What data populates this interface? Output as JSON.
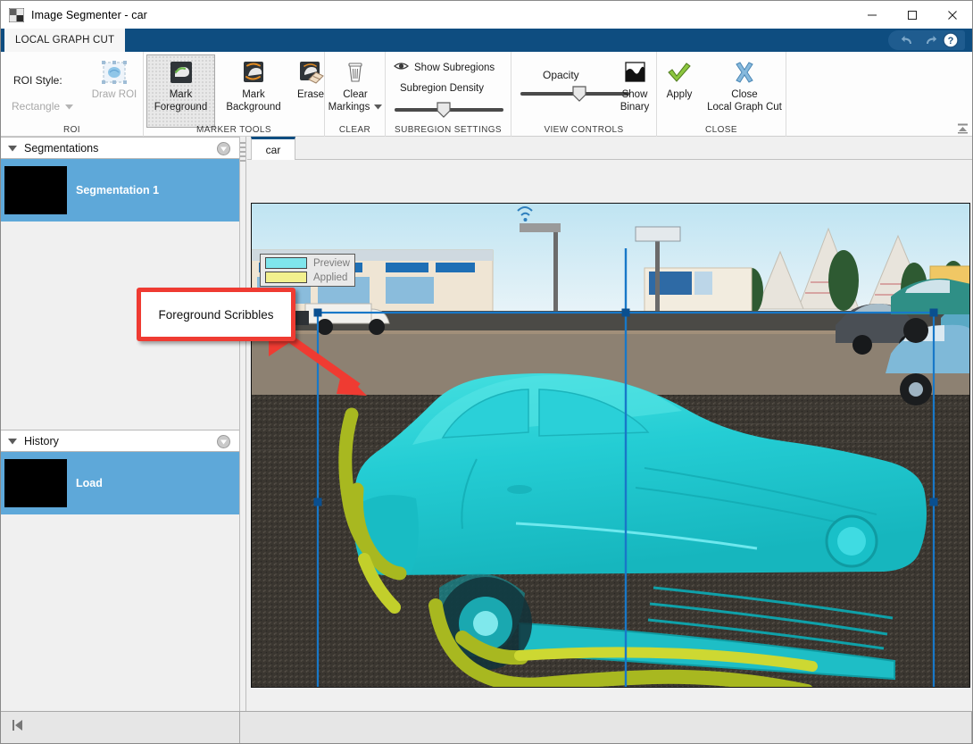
{
  "window": {
    "title": "Image Segmenter - car",
    "app_icon": "image-segmenter-icon",
    "minimize_label": "Minimize",
    "maximize_label": "Maximize",
    "close_label": "Close"
  },
  "ribbon": {
    "tab_label": "LOCAL GRAPH CUT",
    "quick_access": {
      "undo_label": "Undo",
      "redo_label": "Redo",
      "help_label": "Help"
    },
    "collapse_label": "Minimize Ribbon",
    "groups": [
      {
        "name": "ROI",
        "title": "ROI",
        "roi_style_label": "ROI Style:",
        "roi_style_value": "Rectangle",
        "draw_roi_label": "Draw ROI"
      },
      {
        "name": "MARKER TOOLS",
        "title": "MARKER TOOLS",
        "mark_foreground_label": "Mark\nForeground",
        "mark_foreground_line1": "Mark",
        "mark_foreground_line2": "Foreground",
        "mark_background_line1": "Mark",
        "mark_background_line2": "Background",
        "erase_label": "Erase"
      },
      {
        "name": "CLEAR",
        "title": "CLEAR",
        "clear_line1": "Clear",
        "clear_line2": "Markings"
      },
      {
        "name": "SUBREGION SETTINGS",
        "title": "SUBREGION SETTINGS",
        "show_subregions_label": "Show Subregions",
        "subregion_density_label": "Subregion Density",
        "subregion_density_value": 45
      },
      {
        "name": "VIEW CONTROLS",
        "title": "VIEW CONTROLS",
        "opacity_label": "Opacity",
        "opacity_value": 60,
        "show_binary_line1": "Show",
        "show_binary_line2": "Binary"
      },
      {
        "name": "CLOSE",
        "title": "CLOSE",
        "apply_label": "Apply",
        "close_line1": "Close",
        "close_line2": "Local Graph Cut"
      }
    ]
  },
  "sidebar": {
    "segmentations": {
      "title": "Segmentations",
      "items": [
        {
          "label": "Segmentation 1",
          "selected": true
        }
      ]
    },
    "history": {
      "title": "History",
      "items": [
        {
          "label": "Load",
          "selected": true
        }
      ]
    }
  },
  "document": {
    "tab_label": "car"
  },
  "legend": {
    "rows": [
      {
        "label": "Preview",
        "color": "#7fe5ec"
      },
      {
        "label": "Applied",
        "color": "#f2f08e"
      }
    ]
  },
  "annotation": {
    "callout_text": "Foreground Scribbles",
    "border_color": "#ef3b32"
  },
  "colors": {
    "ribbon_accent": "#0e4d80",
    "selection_blue": "#5ea8d9",
    "roi_outline": "#1878c8",
    "mask_cyan": "#21cfd6",
    "scribble_olive": "#a8b820"
  },
  "statusbar": {
    "collapse_panel_label": "Collapse Panel"
  }
}
